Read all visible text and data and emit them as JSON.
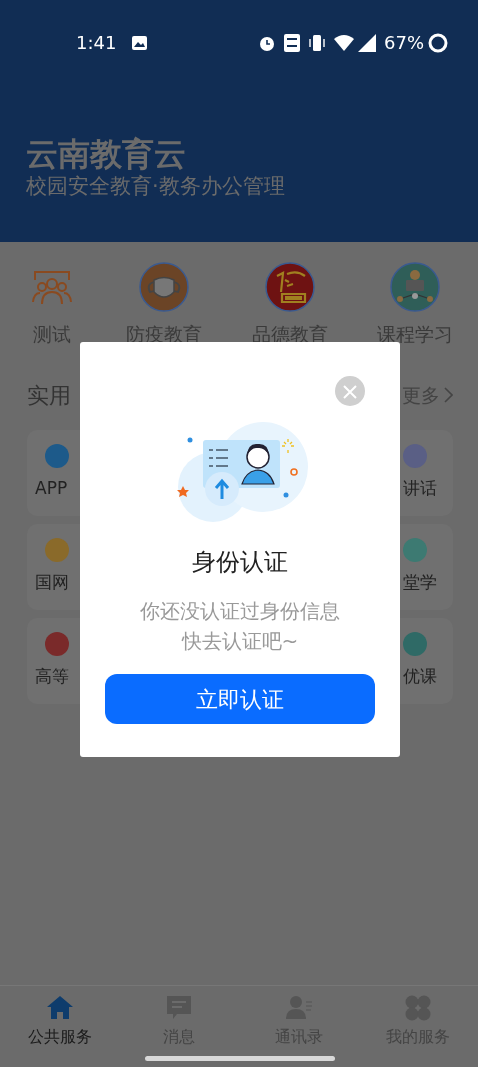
{
  "status_bar": {
    "time": "1:41",
    "battery": "67%"
  },
  "header": {
    "title": "云南教育云",
    "subtitle": "校园安全教育·教务办公管理"
  },
  "categories": [
    {
      "label": "测试",
      "kind": "people"
    },
    {
      "label": "防疫教育",
      "kind": "mask"
    },
    {
      "label": "品德教育",
      "kind": "landmark"
    },
    {
      "label": "课程学习",
      "kind": "teacher"
    }
  ],
  "section": {
    "title": "实用",
    "more": "更多"
  },
  "tile_rows": [
    {
      "left": {
        "label": "APP",
        "color": "#1d5a8a"
      },
      "right": {
        "label": "讲话",
        "color": "#5a5f85"
      }
    },
    {
      "left": {
        "label": "国网",
        "color": "#8a6a2a"
      },
      "right": {
        "label": "堂学",
        "color": "#3d7a72"
      }
    },
    {
      "left": {
        "label": "高等",
        "color": "#7a2a2a"
      },
      "right": {
        "label": "优课",
        "color": "#2f6a66"
      }
    }
  ],
  "dialog": {
    "title": "身份认证",
    "message_lines": [
      "你还没认证过身份信息",
      "快去认证吧~"
    ],
    "button": "立即认证"
  },
  "tab_bar": [
    {
      "label": "公共服务",
      "kind": "home",
      "selected": true
    },
    {
      "label": "消息",
      "kind": "chat",
      "selected": false
    },
    {
      "label": "通讯录",
      "kind": "contact",
      "selected": false
    },
    {
      "label": "我的服务",
      "kind": "grid",
      "selected": false
    }
  ]
}
